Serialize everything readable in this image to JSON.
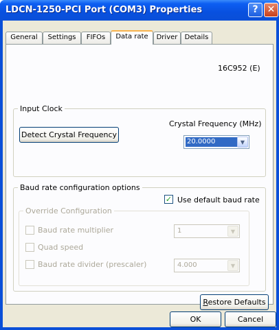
{
  "window": {
    "title": "LDCN-1250-PCI Port (COM3) Properties",
    "help_glyph": "?",
    "close_glyph": "✕"
  },
  "tabs": [
    {
      "label": "General",
      "active": false
    },
    {
      "label": "Settings",
      "active": false
    },
    {
      "label": "FIFOs",
      "active": false
    },
    {
      "label": "Data rate",
      "active": true
    },
    {
      "label": "Driver",
      "active": false
    },
    {
      "label": "Details",
      "active": false
    }
  ],
  "chip_label": "16C952 (E)",
  "input_clock": {
    "legend": "Input Clock",
    "crystal_label": "Crystal Frequency (MHz)",
    "detect_button": "Detect Crystal Frequency",
    "crystal_value": "20.0000"
  },
  "baud": {
    "legend": "Baud rate configuration options",
    "use_default_label": "Use default baud rate",
    "use_default_checked": true,
    "override_legend": "Override Configuration",
    "multiplier_label": "Baud rate multiplier",
    "multiplier_value": "1",
    "quad_label": "Quad speed",
    "divider_label": "Baud rate divider (prescaler)",
    "divider_value": "4.000"
  },
  "buttons": {
    "restore_first": "R",
    "restore_rest": "estore Defaults",
    "ok": "OK",
    "cancel": "Cancel"
  }
}
